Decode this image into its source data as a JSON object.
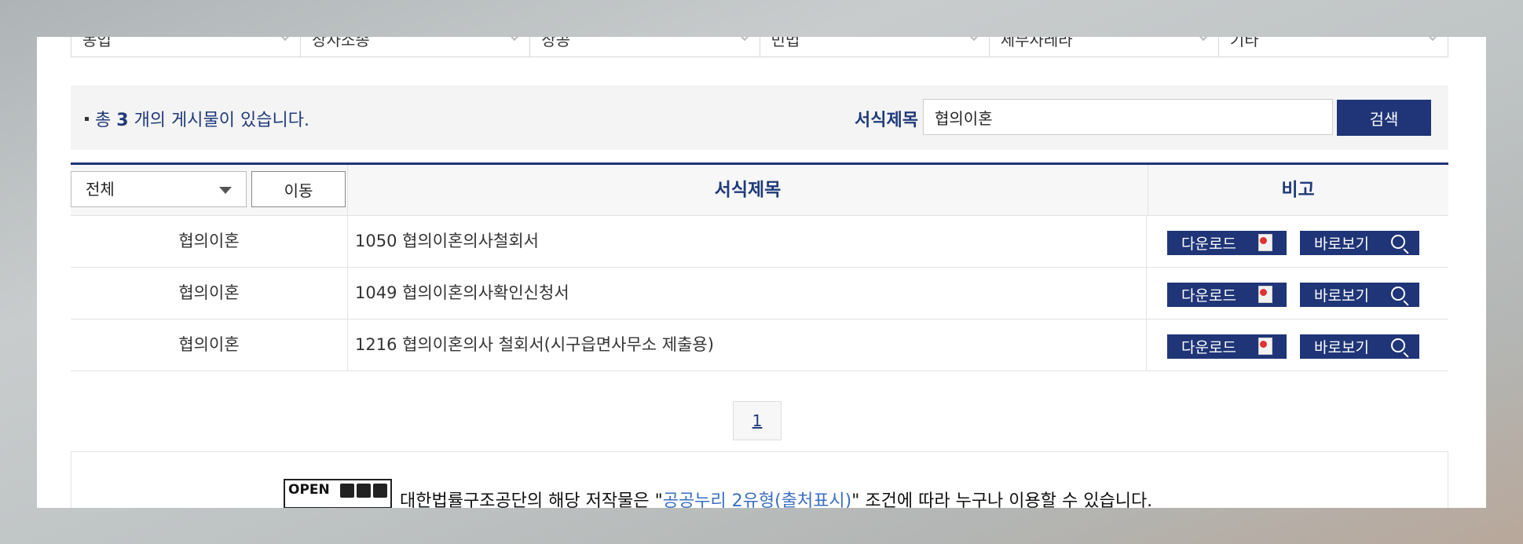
{
  "categories": [
    "농업",
    "상사소송",
    "상공",
    "민법",
    "세무사레라",
    "기타"
  ],
  "summary": {
    "prefix": "총",
    "count": "3",
    "suffix": "개의 게시물이 있습니다."
  },
  "search": {
    "label": "서식제목",
    "value": "협의이혼",
    "button": "검색"
  },
  "table": {
    "filter_select": "전체",
    "move_button": "이동",
    "col_title": "서식제목",
    "col_note": "비고",
    "download_label": "다운로드",
    "view_label": "바로보기",
    "rows": [
      {
        "category": "협의이혼",
        "title": "1050 협의이혼의사철회서"
      },
      {
        "category": "협의이혼",
        "title": "1049 협의이혼의사확인신청서"
      },
      {
        "category": "협의이혼",
        "title": "1216 협의이혼의사 철회서(시구읍면사무소 제출용)"
      }
    ]
  },
  "pagination": {
    "current": "1"
  },
  "license": {
    "logo_text": "OPEN",
    "text_before": "대한법률구조공단의 해당 저작물은 \"",
    "link_text": "공공누리 2유형(출처표시)",
    "text_after": "\" 조건에 따라 누구나 이용할 수 있습니다."
  },
  "colors": {
    "primary": "#1f3577",
    "link": "#3b6fc1"
  }
}
